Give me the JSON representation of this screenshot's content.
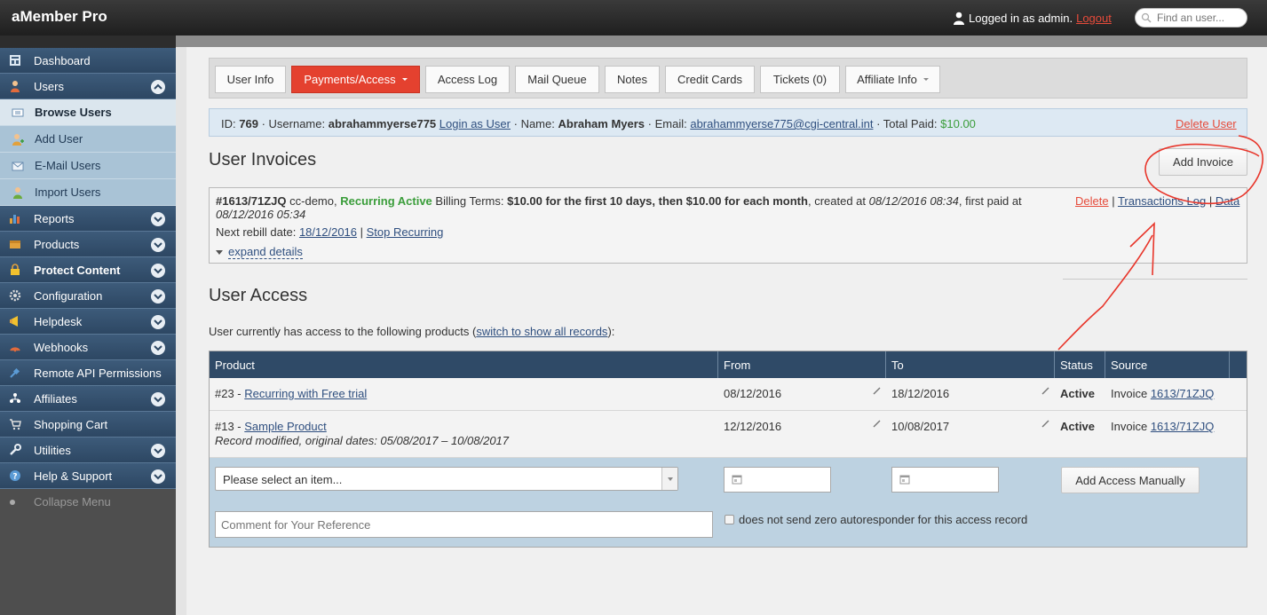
{
  "app": {
    "title": "aMember Pro"
  },
  "header": {
    "logged_in_text": "Logged in as admin.",
    "logout_label": "Logout",
    "search_placeholder": "Find an user..."
  },
  "sidebar": {
    "items": [
      {
        "label": "Dashboard",
        "icon": "dashboard-icon"
      },
      {
        "label": "Users",
        "icon": "user-icon",
        "expanded": true
      },
      {
        "label": "Browse Users",
        "icon": "list-icon",
        "sub": true,
        "active": true
      },
      {
        "label": "Add User",
        "icon": "add-user-icon",
        "sub": true
      },
      {
        "label": "E-Mail Users",
        "icon": "mail-icon",
        "sub": true
      },
      {
        "label": "Import Users",
        "icon": "import-users-icon",
        "sub": true
      },
      {
        "label": "Reports",
        "icon": "bar-chart-icon"
      },
      {
        "label": "Products",
        "icon": "box-icon"
      },
      {
        "label": "Protect Content",
        "icon": "lock-icon"
      },
      {
        "label": "Configuration",
        "icon": "gear-icon"
      },
      {
        "label": "Helpdesk",
        "icon": "megaphone-icon"
      },
      {
        "label": "Webhooks",
        "icon": "webhook-icon"
      },
      {
        "label": "Remote API Permissions",
        "icon": "plug-icon"
      },
      {
        "label": "Affiliates",
        "icon": "affiliates-icon"
      },
      {
        "label": "Shopping Cart",
        "icon": "cart-icon"
      },
      {
        "label": "Utilities",
        "icon": "wrench-icon"
      },
      {
        "label": "Help & Support",
        "icon": "help-icon"
      }
    ],
    "collapse_label": "Collapse Menu"
  },
  "tabs": [
    {
      "label": "User Info"
    },
    {
      "label": "Payments/Access",
      "active": true
    },
    {
      "label": "Access Log"
    },
    {
      "label": "Mail Queue"
    },
    {
      "label": "Notes"
    },
    {
      "label": "Credit Cards"
    },
    {
      "label": "Tickets (0)"
    },
    {
      "label": "Affiliate Info"
    }
  ],
  "user": {
    "id_label": "ID:",
    "id": "769",
    "username_label": "· Username:",
    "username": "abrahammyerse775",
    "login_as": "Login as User",
    "name_label": "· Name:",
    "name": "Abraham Myers",
    "email_label": "· Email:",
    "email": "abrahammyerse775@cgi-central.int",
    "total_label": "· Total Paid:",
    "total_paid": "$10.00",
    "delete_label": "Delete User"
  },
  "invoices": {
    "heading": "User Invoices",
    "add_button": "Add Invoice",
    "items": [
      {
        "id": "#1613/71ZJQ",
        "paysys": "cc-demo,",
        "status": "Recurring Active",
        "terms_label": "Billing Terms:",
        "terms": "$10.00 for the first 10 days, then $10.00 for each month",
        "created_label": ", created at",
        "created": "08/12/2016 08:34",
        "first_paid_label": ", first paid at",
        "first_paid": "08/12/2016 05:34",
        "next_rebill_label": "Next rebill date:",
        "next_rebill": "18/12/2016",
        "stop_label": "Stop Recurring",
        "expand_label": "expand details",
        "actions": {
          "delete": "Delete",
          "transactions": "Transactions Log",
          "data": "Data"
        }
      }
    ]
  },
  "access": {
    "heading": "User Access",
    "description_before": "User currently has access to the following products (",
    "switch_link": "switch to show all records",
    "description_after": "):",
    "columns": [
      "Product",
      "From",
      "To",
      "Status",
      "Source"
    ],
    "rows": [
      {
        "product_prefix": "#23 -",
        "product": "Recurring with Free trial",
        "note": "",
        "from": "08/12/2016",
        "to": "18/12/2016",
        "status": "Active",
        "source_prefix": "Invoice",
        "source": "1613/71ZJQ"
      },
      {
        "product_prefix": "#13 -",
        "product": "Sample Product",
        "note": "Record modified, original dates: 05/08/2017 – 10/08/2017",
        "from": "12/12/2016",
        "to": "10/08/2017",
        "status": "Active",
        "source_prefix": "Invoice",
        "source": "1613/71ZJQ"
      }
    ],
    "form": {
      "select_value": "Please select an item...",
      "add_button": "Add Access Manually",
      "comment_placeholder": "Comment for Your Reference",
      "checkbox_label": "does not send zero autoresponder for this access record"
    }
  },
  "colors": {
    "accent": "#e4412f",
    "nav": "#2f4a67",
    "link_red": "#e64b3b",
    "success": "#3a9d3a"
  }
}
